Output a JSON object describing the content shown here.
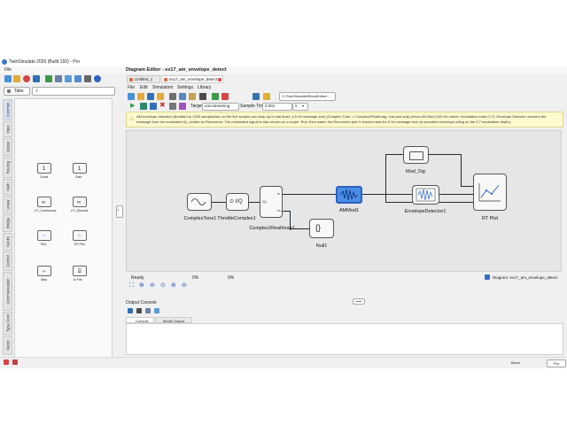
{
  "window": {
    "title": "TwinSimulate 2026 (Build 192) - Pro"
  },
  "menubar": {
    "file": "File"
  },
  "left_panel": {
    "tab_label": "Tabs",
    "side_tabs": [
      "Common",
      "Input",
      "Output",
      "Routing",
      "Math",
      "Linear",
      "Bridge",
      "Nonlin",
      "Control",
      "Communication",
      "Type Conv",
      "Vector"
    ],
    "blocks": [
      {
        "label": "Const",
        "glyph": "1"
      },
      {
        "label": "Gain",
        "glyph": "1"
      },
      {
        "label": "LTI_Continuous",
        "glyph": "∞"
      },
      {
        "label": "LTI_Discrete",
        "glyph": "∞"
      },
      {
        "label": "Plot",
        "glyph": "~"
      },
      {
        "label": "RT Plot",
        "glyph": "~"
      },
      {
        "label": "Step",
        "glyph": "⌐"
      },
      {
        "label": "to File",
        "glyph": "⌸"
      }
    ]
  },
  "editor": {
    "header": "Diagram Editor - ex17_am_envelope_detect",
    "tabs": [
      "Untitled_1",
      "ex17_am_envelope_detect"
    ],
    "menu": [
      "File",
      "Edit",
      "Simulation",
      "Settings",
      "Library"
    ],
    "path_value": "C:\\TwinSimulate\\BlockEditor\\...",
    "target_label": "Target:",
    "target_value": "umcstreaming",
    "sample_time_label": "Sample Time:",
    "sample_time_value": "0.001",
    "unit_value": "s",
    "info_text": "AM envelope detection (throttled to 1000 samples/sec so the live scopes can keep up in real time): a 5 Hz message tone (Complex Tone -> Complex2RealImag, real part only) drives AM Mod (100 Hz carrier, modulation index 0.7); Envelope Detector recovers the message from the modulated IQ, plotted as Recovered. The modulated signal is also shown on a scope. Run, then watch the Recovered plot: it should track the 5 Hz message tone (a smoothed envelope riding on the 0.7 modulation depth).",
    "blocks": {
      "complex_tone": "ComplexTone1",
      "throttle": "ThrottleComplex1",
      "c2ri": "Complex2RealImag1",
      "ammod": "AMMod1",
      "null": "Null1",
      "mod_sig": "Mod_Sig",
      "env": "EnvelopeDetector1",
      "rt_plot": "RT Plot"
    },
    "ports": {
      "re": "re",
      "im": "im",
      "iq": "I/Q"
    },
    "status": {
      "ready": "Ready",
      "pct1": "0%",
      "pct2": "0%",
      "diagram": "Diagram: ex17_am_envelope_detect"
    }
  },
  "output_console": {
    "title": "Output Console",
    "tabs": [
      "Console",
      "Model Output"
    ]
  },
  "statusbar": {
    "right_a": "Block",
    "right_b": "Pro"
  }
}
